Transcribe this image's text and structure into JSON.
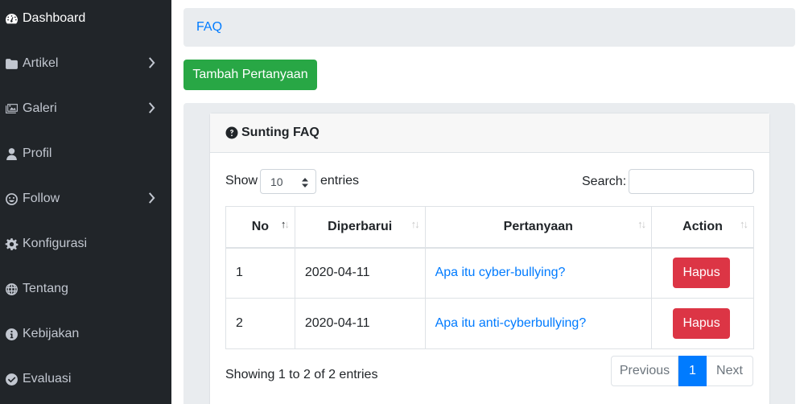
{
  "sidebar": {
    "items": [
      {
        "label": "Dashboard",
        "icon": "tachometer-icon",
        "has_submenu": false,
        "active": true
      },
      {
        "label": "Artikel",
        "icon": "folder-icon",
        "has_submenu": true,
        "active": false
      },
      {
        "label": "Galeri",
        "icon": "images-icon",
        "has_submenu": true,
        "active": false
      },
      {
        "label": "Profil",
        "icon": "user-icon",
        "has_submenu": false,
        "active": false
      },
      {
        "label": "Follow",
        "icon": "smile-icon",
        "has_submenu": true,
        "active": false
      },
      {
        "label": "Konfigurasi",
        "icon": "cog-icon",
        "has_submenu": false,
        "active": false
      },
      {
        "label": "Tentang",
        "icon": "globe-icon",
        "has_submenu": false,
        "active": false
      },
      {
        "label": "Kebijakan",
        "icon": "info-circle-icon",
        "has_submenu": false,
        "active": false
      },
      {
        "label": "Evaluasi",
        "icon": "check-circle-icon",
        "has_submenu": false,
        "active": false
      }
    ]
  },
  "breadcrumb": {
    "current": "FAQ"
  },
  "toolbar": {
    "add_label": "Tambah Pertanyaan"
  },
  "card": {
    "title": "Sunting FAQ",
    "title_icon": "question-circle-icon",
    "show_label": "Show",
    "entries_label": "entries",
    "page_length": "10",
    "search_label": "Search:",
    "search_value": ""
  },
  "table": {
    "columns": [
      "No",
      "Diperbarui",
      "Pertanyaan",
      "Action"
    ],
    "sorted_column": "No",
    "sort_direction": "asc",
    "rows": [
      {
        "no": "1",
        "date": "2020-04-11",
        "question": "Apa itu cyber-bullying?",
        "action": "Hapus"
      },
      {
        "no": "2",
        "date": "2020-04-11",
        "question": "Apa itu anti-cyberbullying?",
        "action": "Hapus"
      }
    ]
  },
  "footer": {
    "info": "Showing 1 to 2 of 2 entries",
    "previous": "Previous",
    "current_page": "1",
    "next": "Next"
  },
  "colors": {
    "sidebar_bg": "#212529",
    "success": "#28a745",
    "danger": "#dc3545",
    "primary": "#007bff"
  }
}
